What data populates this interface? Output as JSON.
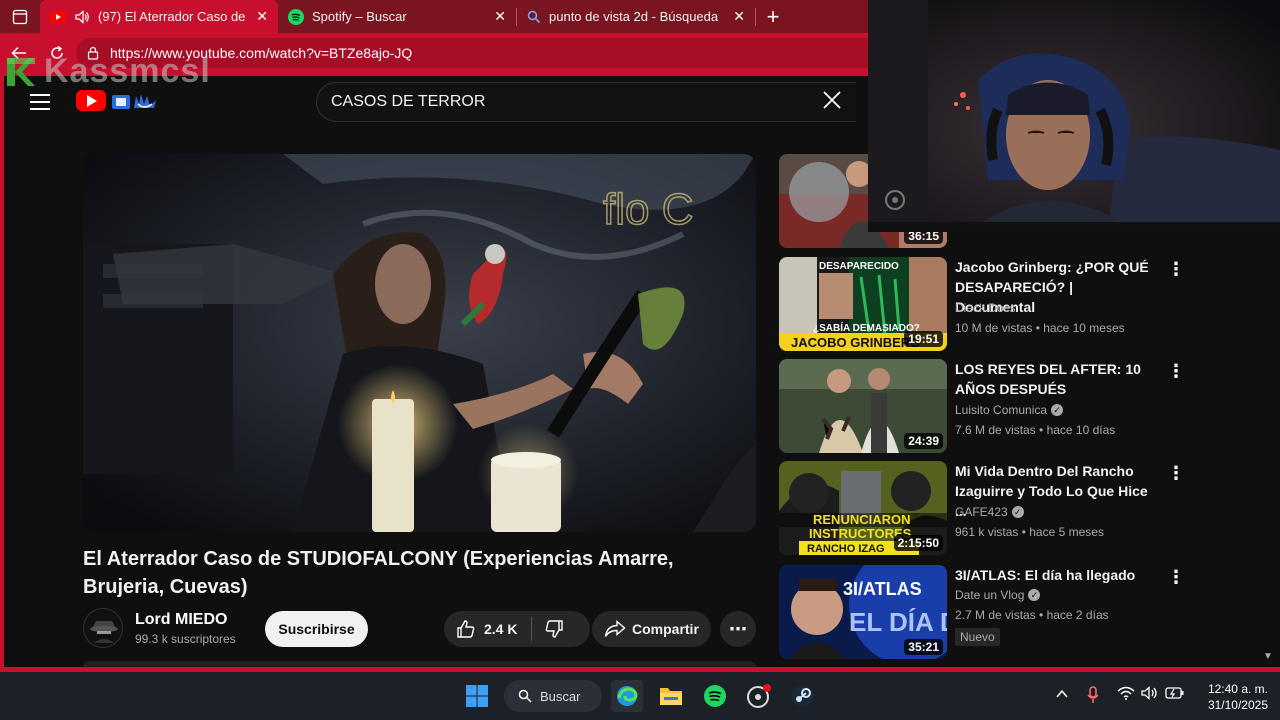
{
  "browser": {
    "tabs": [
      {
        "title": "(97) El Aterrador Caso de STUDIOFALCONY",
        "icon": "youtube-icon",
        "active": true
      },
      {
        "title": "Spotify – Buscar",
        "icon": "spotify-icon",
        "active": false
      },
      {
        "title": "punto de vista 2d - Búsqueda",
        "icon": "search-icon",
        "active": false
      }
    ],
    "url": "https://www.youtube.com/watch?v=BTZe8ajo-JQ"
  },
  "watermark": {
    "text": "Kassmcsl"
  },
  "youtube": {
    "search_query": "CASOS DE TERROR",
    "video": {
      "title": "El Aterrador Caso de STUDIOFALCONY (Experiencias Amarre, Brujeria, Cuevas)",
      "channel": "Lord MIEDO",
      "subscribers": "99.3 k suscriptores",
      "subscribe_label": "Suscribirse",
      "likes": "2.4 K",
      "share_label": "Compartir"
    },
    "recommendations": [
      {
        "title": "",
        "channel": "",
        "meta": "",
        "duration": "36:15",
        "verified": false
      },
      {
        "title": "Jacobo Grinberg: ¿POR QUÉ DESAPARECIÓ? | Documental",
        "channel": "Dieck Docs",
        "meta": "10 M de vistas • hace 10 meses",
        "duration": "19:51",
        "verified": false,
        "thumb_text_top": "DESAPARECIDO",
        "thumb_text_mid": "¿SABÍA DEMASIADO?",
        "thumb_text_bottom": "JACOBO GRINBERG"
      },
      {
        "title": "LOS REYES DEL AFTER: 10 AÑOS DESPUÉS",
        "channel": "Luisito Comunica",
        "meta": "7.6 M de vistas • hace 10 días",
        "duration": "24:39",
        "verified": true
      },
      {
        "title": "Mi Vida Dentro Del Rancho Izaguirre y Todo Lo Que Hice ...",
        "channel": "GAFE423",
        "meta": "961 k vistas • hace 5 meses",
        "duration": "2:15:50",
        "verified": true,
        "thumb_text_a": "RENUNCIARON",
        "thumb_text_b": "INSTRUCTORES",
        "thumb_text_c": "RANCHO IZAG"
      },
      {
        "title": "3I/ATLAS: El día ha llegado",
        "channel": "Date un Vlog",
        "meta": "2.7 M de vistas • hace 2 días",
        "duration": "35:21",
        "verified": true,
        "badge": "Nuevo",
        "thumb_text_a": "3I/ATLAS",
        "thumb_text_b": "EL DÍA D"
      }
    ]
  },
  "taskbar": {
    "search_label": "Buscar",
    "time": "12:40 a. m.",
    "date": "31/10/2025"
  },
  "colors": {
    "browser_red": "#c8102e",
    "youtube_red": "#ff0000",
    "background": "#0f0f0f"
  }
}
